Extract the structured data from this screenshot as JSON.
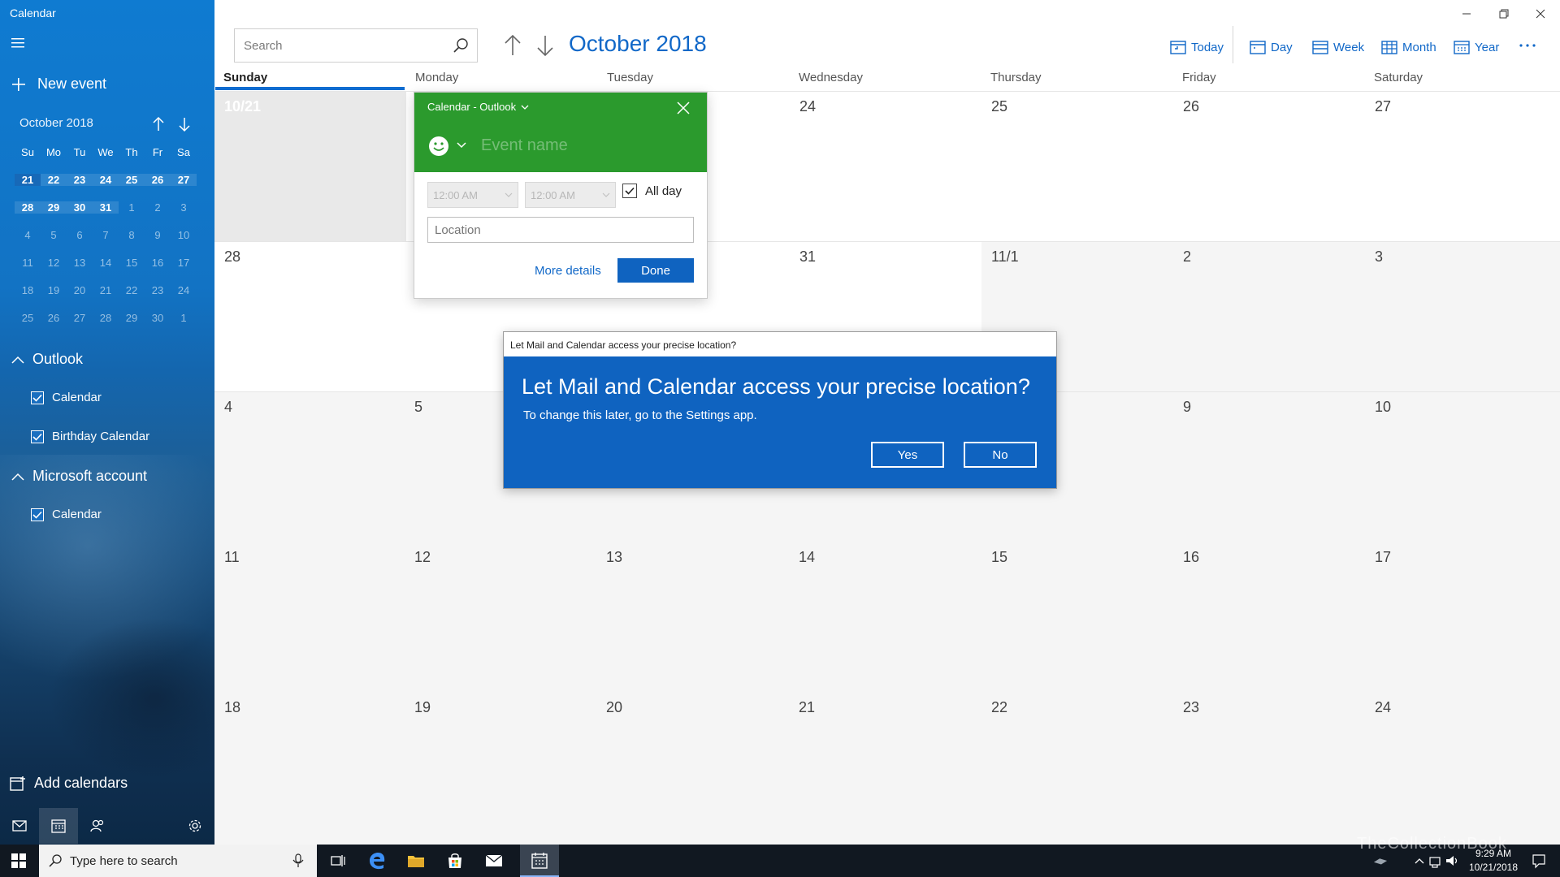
{
  "app": {
    "title": "Calendar"
  },
  "sidebar": {
    "new_event": "New event",
    "mini_calendar": {
      "month_label": "October 2018",
      "weekdays": [
        "Su",
        "Mo",
        "Tu",
        "We",
        "Th",
        "Fr",
        "Sa"
      ],
      "weeks": [
        [
          "21",
          "22",
          "23",
          "24",
          "25",
          "26",
          "27"
        ],
        [
          "28",
          "29",
          "30",
          "31",
          "1",
          "2",
          "3"
        ],
        [
          "4",
          "5",
          "6",
          "7",
          "8",
          "9",
          "10"
        ],
        [
          "11",
          "12",
          "13",
          "14",
          "15",
          "16",
          "17"
        ],
        [
          "18",
          "19",
          "20",
          "21",
          "22",
          "23",
          "24"
        ],
        [
          "25",
          "26",
          "27",
          "28",
          "29",
          "30",
          "1"
        ]
      ]
    },
    "groups": [
      {
        "title": "Outlook",
        "items": [
          "Calendar",
          "Birthday Calendar"
        ]
      },
      {
        "title": "Microsoft account",
        "items": [
          "Calendar"
        ]
      }
    ],
    "add_calendars": "Add calendars"
  },
  "header": {
    "search_placeholder": "Search",
    "month_title": "October 2018",
    "toolbar": {
      "today": "Today",
      "day": "Day",
      "week": "Week",
      "month": "Month",
      "year": "Year"
    }
  },
  "weekdays": [
    "Sunday",
    "Monday",
    "Tuesday",
    "Wednesday",
    "Thursday",
    "Friday",
    "Saturday"
  ],
  "grid": [
    [
      "10/21",
      "",
      "",
      "24",
      "25",
      "26",
      "27"
    ],
    [
      "28",
      "",
      "",
      "31",
      "11/1",
      "2",
      "3"
    ],
    [
      "4",
      "5",
      "",
      "",
      "",
      "9",
      "10"
    ],
    [
      "11",
      "12",
      "13",
      "14",
      "15",
      "16",
      "17"
    ],
    [
      "18",
      "19",
      "20",
      "21",
      "22",
      "23",
      "24"
    ]
  ],
  "event_popup": {
    "calendar": "Calendar - Outlook",
    "name_placeholder": "Event name",
    "start_time": "12:00 AM",
    "end_time": "12:00 AM",
    "all_day": "All day",
    "location_placeholder": "Location",
    "more_details": "More details",
    "done": "Done"
  },
  "dialog": {
    "titlebar": "Let Mail and Calendar access your precise location?",
    "heading": "Let Mail and Calendar access your precise location?",
    "subtext": "To change this later, go to the Settings app.",
    "yes": "Yes",
    "no": "No"
  },
  "taskbar": {
    "search_placeholder": "Type here to search",
    "time": "9:29 AM",
    "date": "10/21/2018",
    "watermark": "TheCollectionBook"
  },
  "colors": {
    "accent": "#0f63c0",
    "event_green": "#2b9a2d",
    "sidebar": "#1273c4"
  }
}
